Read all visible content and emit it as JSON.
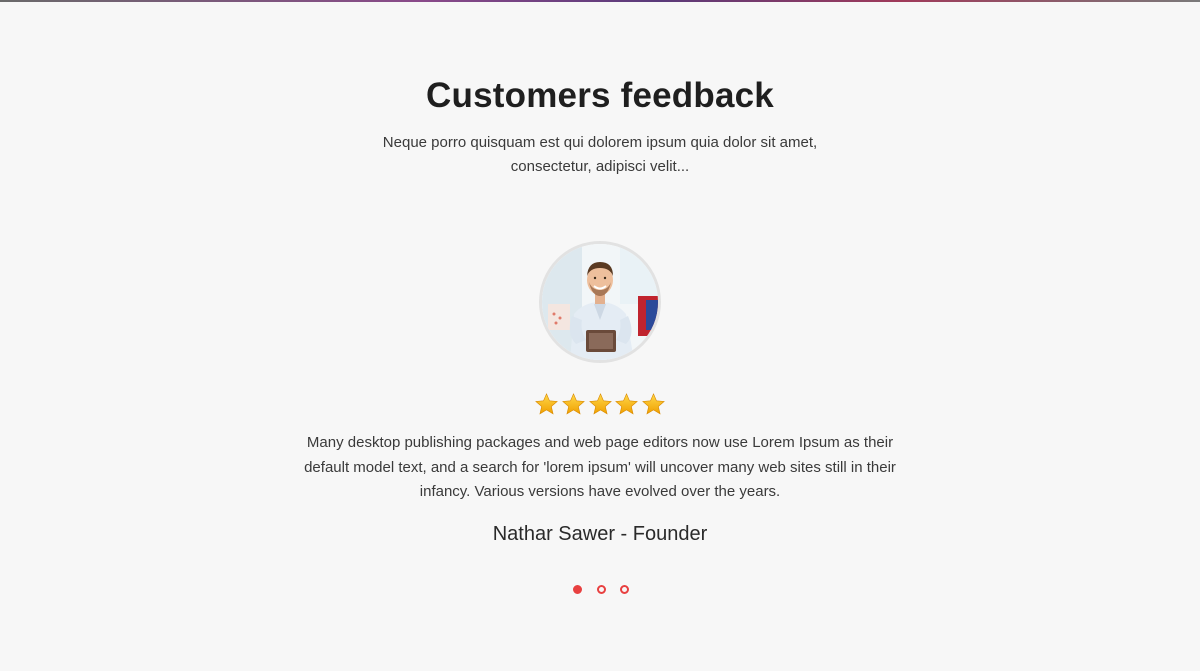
{
  "section": {
    "title": "Customers feedback",
    "subtitle": "Neque porro quisquam est qui dolorem ipsum quia dolor sit amet, consectetur, adipisci velit..."
  },
  "testimonial": {
    "avatar_icon": "person-photo",
    "rating": 5,
    "rating_max": 5,
    "quote": "Many desktop publishing packages and web page editors now use Lorem Ipsum as their default model text, and a search for 'lorem ipsum' will uncover many web sites still in their infancy. Various versions have evolved over the years.",
    "author": "Nathar Sawer - Founder"
  },
  "carousel": {
    "slides": 3,
    "active_index": 0
  },
  "colors": {
    "accent": "#e84040",
    "star": "#f5b400",
    "background": "#f7f7f7"
  }
}
